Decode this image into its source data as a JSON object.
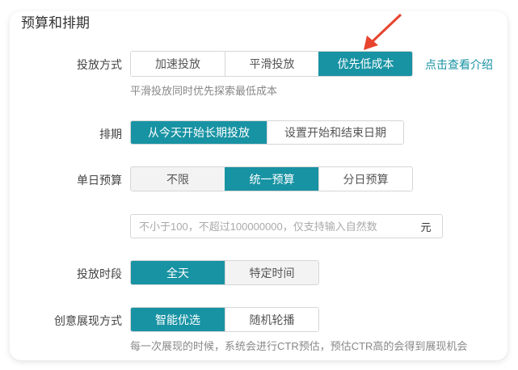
{
  "section_title": "预算和排期",
  "delivery": {
    "label": "投放方式",
    "options": [
      "加速投放",
      "平滑投放",
      "优先低成本"
    ],
    "selected": 2,
    "link": "点击查看介绍",
    "hint": "平滑投放同时优先探索最低成本"
  },
  "schedule": {
    "label": "排期",
    "options": [
      "从今天开始长期投放",
      "设置开始和结束日期"
    ],
    "selected": 0
  },
  "budget": {
    "label": "单日预算",
    "options": [
      "不限",
      "统一预算",
      "分日预算"
    ],
    "selected": 1,
    "input_value": "",
    "placeholder": "不小于100，不超过100000000，仅支持输入自然数",
    "unit": "元"
  },
  "time_slot": {
    "label": "投放时段",
    "options": [
      "全天",
      "特定时间"
    ],
    "selected": 0
  },
  "creative": {
    "label": "创意展现方式",
    "options": [
      "智能优选",
      "随机轮播"
    ],
    "selected": 0,
    "hint": "每一次展现的时候，系统会进行CTR预估，预估CTR高的会得到展现机会"
  },
  "colors": {
    "accent": "#1893a3",
    "arrow": "#e8432e"
  }
}
